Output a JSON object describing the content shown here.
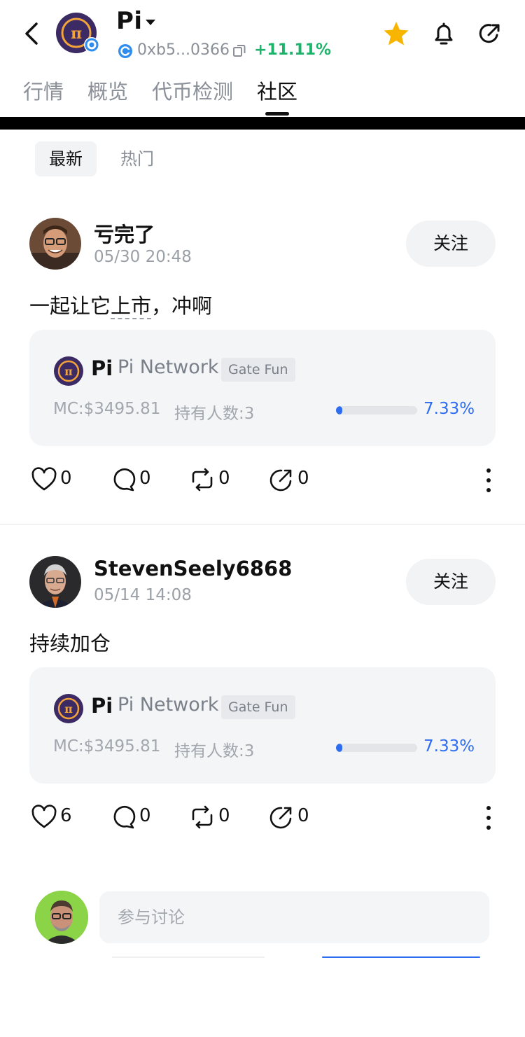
{
  "header": {
    "token_name": "Pi",
    "address": "0xb5...0366",
    "change": "+11.11%"
  },
  "tabs": [
    {
      "label": "行情",
      "active": false
    },
    {
      "label": "概览",
      "active": false
    },
    {
      "label": "代币检测",
      "active": false
    },
    {
      "label": "社区",
      "active": true
    }
  ],
  "subtabs": {
    "latest": "最新",
    "hot": "热门"
  },
  "colors": {
    "accent_blue": "#2f6df0",
    "positive_green": "#1db36b",
    "star_yellow": "#f7b500",
    "pi_purple": "#3b2a63"
  },
  "posts": [
    {
      "username": "亏完了",
      "time": "05/30 20:48",
      "follow_label": "关注",
      "text_before": "一起让它",
      "text_link": "上市",
      "text_after": "，冲啊",
      "card": {
        "symbol": "Pi",
        "name": "Pi Network",
        "tag": "Gate Fun",
        "mc": "MC:$3495.81",
        "holders": "持有人数:3",
        "progress_text": "7.33%",
        "progress": 0.0733
      },
      "likes": "0",
      "comments": "0",
      "reposts": "0",
      "shares": "0"
    },
    {
      "username": "StevenSeely6868",
      "time": "05/14 14:08",
      "follow_label": "关注",
      "text_before": "持续加仓",
      "text_link": "",
      "text_after": "",
      "card": {
        "symbol": "Pi",
        "name": "Pi Network",
        "tag": "Gate Fun",
        "mc": "MC:$3495.81",
        "holders": "持有人数:3",
        "progress_text": "7.33%",
        "progress": 0.0733
      },
      "likes": "6",
      "comments": "0",
      "reposts": "0",
      "shares": "0"
    }
  ],
  "comment_box": {
    "placeholder": "参与讨论"
  }
}
